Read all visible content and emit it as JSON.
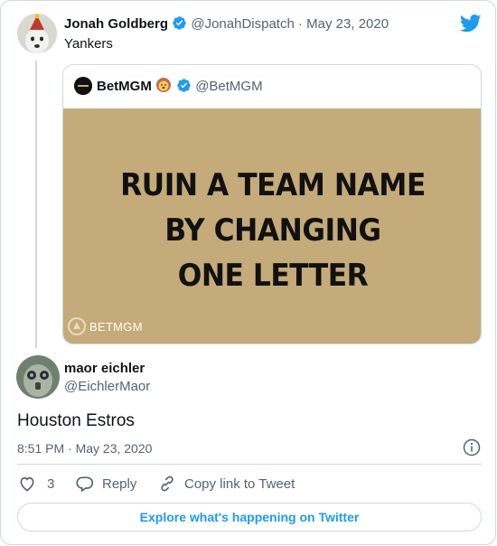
{
  "tweet": {
    "author_name": "Jonah Goldberg",
    "author_handle": "@JonahDispatch",
    "separator": "·",
    "date": "May 23, 2020",
    "text": "Yankers"
  },
  "quoted_tweet": {
    "author_name": "BetMGM",
    "author_handle": "@BetMGM",
    "image_headline": [
      "RUIN A TEAM NAME",
      "BY CHANGING",
      "ONE LETTER"
    ],
    "image_brand": "BETMGM"
  },
  "reply": {
    "author_name": "maor eichler",
    "author_handle": "@EichlerMaor",
    "text": "Houston Estros",
    "timestamp": "8:51 PM · May 23, 2020"
  },
  "actions": {
    "like_count": "3",
    "reply_label": "Reply",
    "copy_link_label": "Copy link to Tweet"
  },
  "footer": {
    "explore_label": "Explore what's happening on Twitter"
  },
  "colors": {
    "accent": "#1d9bf0",
    "image_background": "#c4ab79",
    "border": "#cfd9de"
  },
  "icons": [
    "twitter-bird-icon",
    "verified-badge-icon",
    "lion-emoji-icon",
    "info-icon",
    "heart-icon",
    "reply-bubble-icon",
    "link-icon"
  ]
}
